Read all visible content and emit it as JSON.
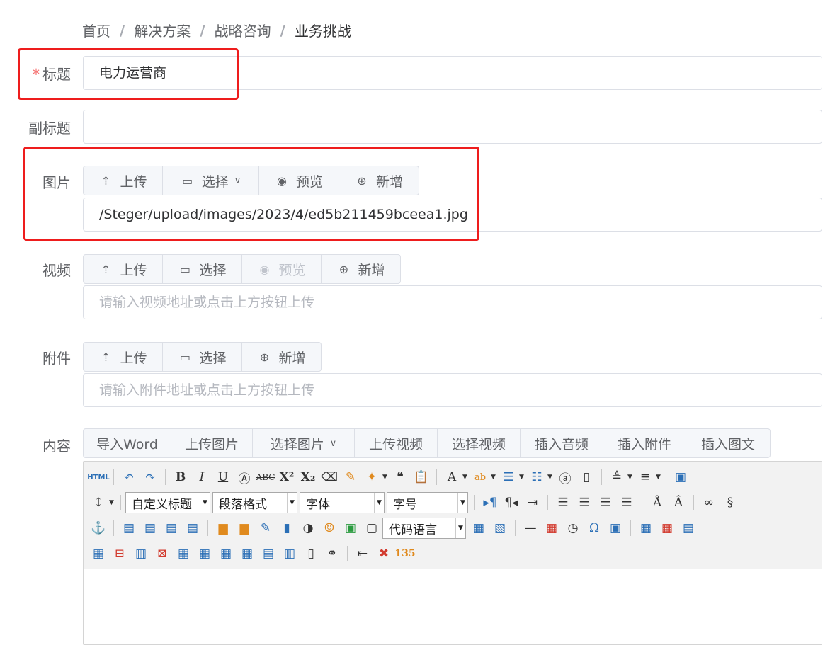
{
  "breadcrumb": {
    "items": [
      "首页",
      "解决方案",
      "战略咨询"
    ],
    "current": "业务挑战",
    "separator": "/"
  },
  "fields": {
    "title": {
      "label": "标题",
      "required_mark": "*",
      "value": "电力运营商"
    },
    "subtitle": {
      "label": "副标题",
      "value": ""
    },
    "image": {
      "label": "图片",
      "buttons": {
        "upload": "上传",
        "select": "选择",
        "preview": "预览",
        "add": "新增"
      },
      "value": "/Steger/upload/images/2023/4/ed5b211459bceea1.jpg"
    },
    "video": {
      "label": "视频",
      "buttons": {
        "upload": "上传",
        "select": "选择",
        "preview": "预览",
        "add": "新增"
      },
      "placeholder": "请输入视频地址或点击上方按钮上传"
    },
    "attachment": {
      "label": "附件",
      "buttons": {
        "upload": "上传",
        "select": "选择",
        "add": "新增"
      },
      "placeholder": "请输入附件地址或点击上方按钮上传"
    },
    "content": {
      "label": "内容",
      "buttons": {
        "import_word": "导入Word",
        "upload_image": "上传图片",
        "select_image": "选择图片",
        "upload_video": "上传视频",
        "select_video": "选择视频",
        "insert_audio": "插入音频",
        "insert_attachment": "插入附件",
        "insert_graphic": "插入图文"
      }
    }
  },
  "editor": {
    "html_label": "HTML",
    "selects": {
      "custom_heading": "自定义标题",
      "paragraph_format": "段落格式",
      "font_family": "字体",
      "font_size": "字号",
      "code_language": "代码语言"
    }
  },
  "colors": {
    "highlight_box": "#ee1d1d",
    "required": "#f56c6c",
    "border": "#dcdfe6"
  }
}
